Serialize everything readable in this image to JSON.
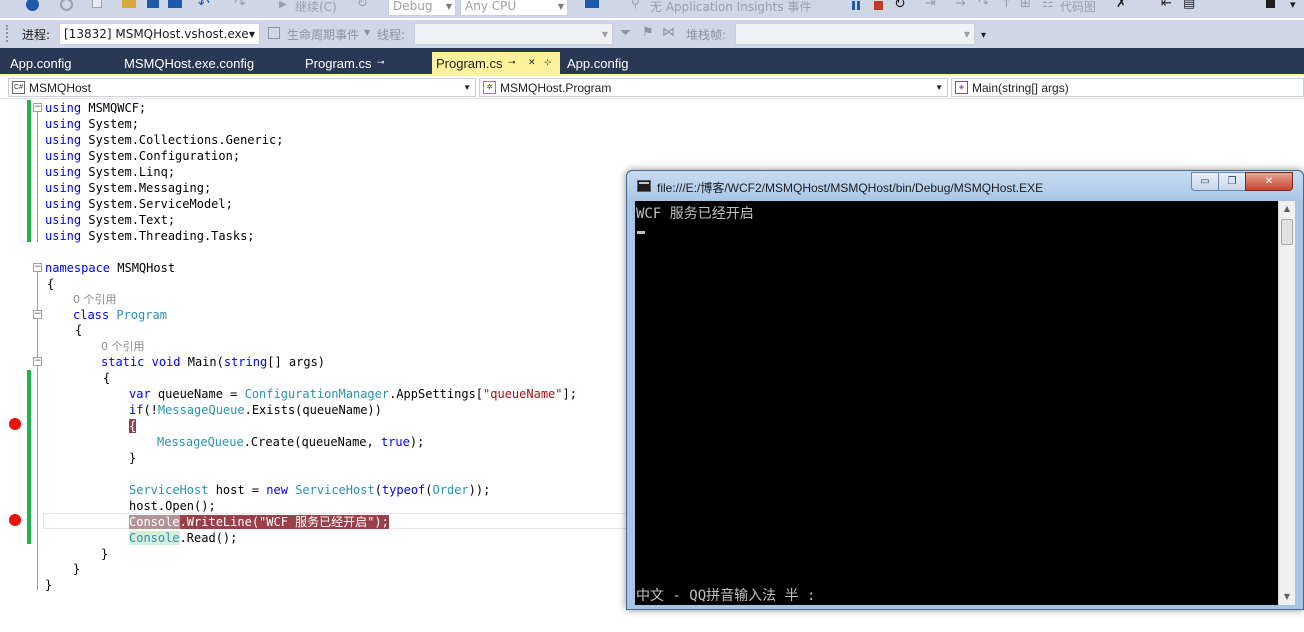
{
  "toolbar1": {
    "continue_label": "继续(C)",
    "config_value": "Debug",
    "platform_value": "Any CPU",
    "insights_label": "无 Application Insights 事件",
    "codemap_label": "代码图"
  },
  "toolbar2": {
    "process_label": "进程:",
    "process_value": "[13832] MSMQHost.vshost.exe",
    "lifecycle_label": "生命周期事件",
    "thread_label": "线程:",
    "thread_value": "",
    "stackframe_label": "堆栈帧:",
    "stackframe_value": ""
  },
  "tabs": [
    {
      "label": "App.config",
      "active": false
    },
    {
      "label": "MSMQHost.exe.config",
      "active": false
    },
    {
      "label": "Program.cs",
      "active": false,
      "pinned": true
    },
    {
      "label": "Program.cs",
      "active": true,
      "pinned": true
    },
    {
      "label": "App.config",
      "active": false
    }
  ],
  "navbar": {
    "project": "MSMQHost",
    "type": "MSMQHost.Program",
    "member": "Main(string[] args)"
  },
  "code": {
    "l1_kw": "using",
    "l1_rest": " MSMQWCF;",
    "l2_kw": "using",
    "l2_rest": " System;",
    "l3_kw": "using",
    "l3_rest": " System.Collections.Generic;",
    "l4_kw": "using",
    "l4_rest": " System.Configuration;",
    "l5_kw": "using",
    "l5_rest": " System.Linq;",
    "l6_kw": "using",
    "l6_rest": " System.Messaging;",
    "l7_kw": "using",
    "l7_rest": " System.ServiceModel;",
    "l8_kw": "using",
    "l8_rest": " System.Text;",
    "l9_kw": "using",
    "l9_rest": " System.Threading.Tasks;",
    "ns_kw": "namespace",
    "ns_rest": " MSMQHost",
    "open_brace": "{",
    "close_brace": "}",
    "refs0": "0 个引用",
    "class_kw": "class",
    "class_name": "Program",
    "static_kw": "static",
    "void_kw": "void",
    "main_name": " Main(",
    "string_kw": "string",
    "main_rest": "[] args)",
    "var_kw": "var",
    "var_rest": " queueName = ",
    "cm_type": "ConfigurationManager",
    "cm_rest": ".AppSettings[",
    "queue_str": "\"queueName\"",
    "cm_end": "];",
    "if_kw": "if",
    "if_rest1": "(!",
    "mq_type": "MessageQueue",
    "if_rest2": ".Exists(queueName))",
    "mq_type2": "MessageQueue",
    "create_rest": ".Create(queueName, ",
    "true_kw": "true",
    "create_end": ");",
    "sh_type": "ServiceHost",
    "sh_rest": " host = ",
    "new_kw": "new",
    "sh_type2": "ServiceHost",
    "sh_paren": "(",
    "typeof_kw": "typeof",
    "sh_paren2": "(",
    "order_type": "Order",
    "sh_end": "));",
    "open_call": "host.Open();",
    "console_type": "Console",
    "writeline_rest": ".WriteLine(\"WCF 服务已经开启\");",
    "console_type2": "Console",
    "read_rest": ".Read();"
  },
  "console_window": {
    "title": "file:///E:/博客/WCF2/MSMQHost/MSMQHost/bin/Debug/MSMQHost.EXE",
    "output_line": "WCF 服务已经开启",
    "ime_status": "中文 - QQ拼音输入法 半 :",
    "minimize_label": "▭",
    "maximize_label": "❐",
    "close_label": "✕"
  }
}
